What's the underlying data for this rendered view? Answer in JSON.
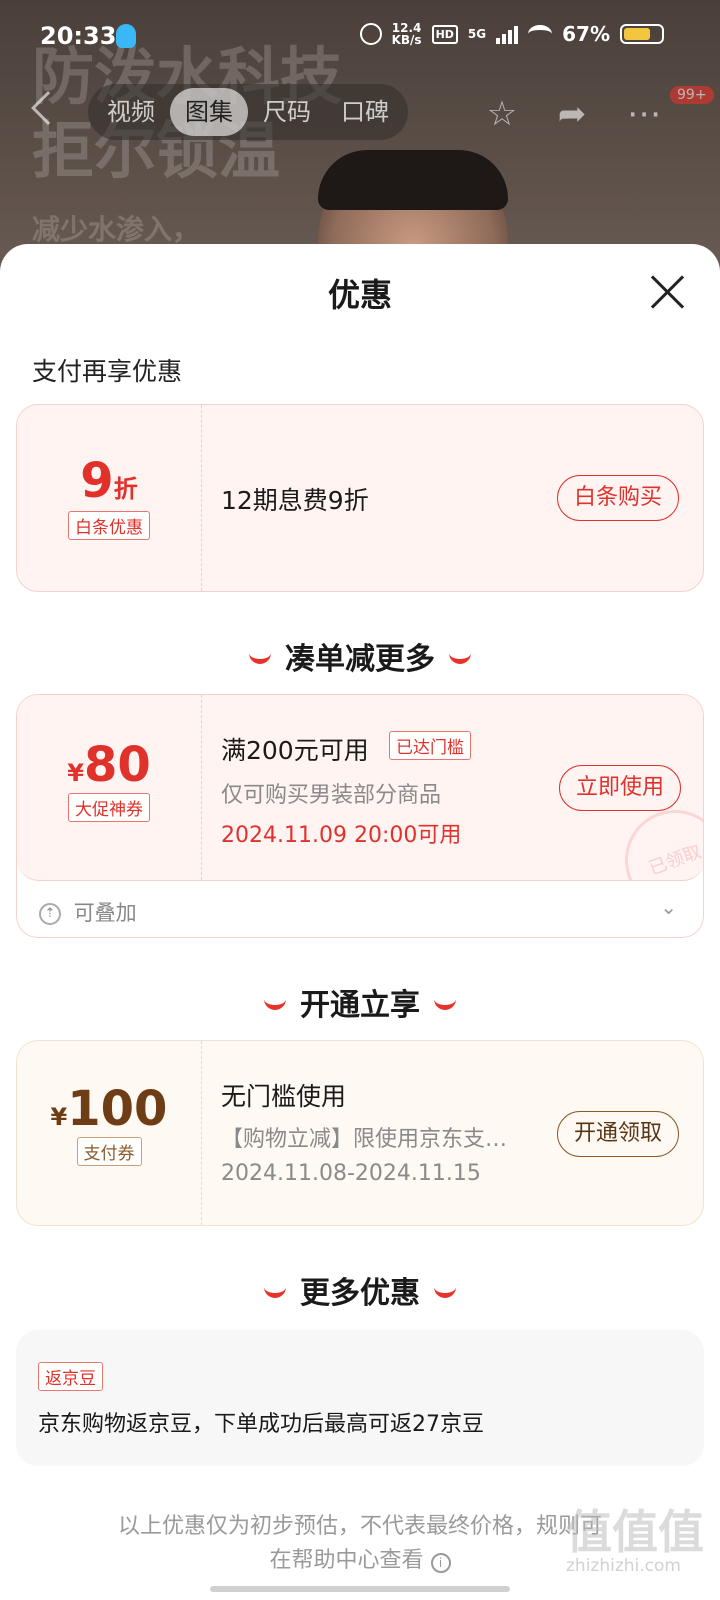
{
  "status": {
    "time": "20:33",
    "speed_value": "12.4",
    "speed_unit": "KB/s",
    "hd": "HD",
    "net": "5G",
    "battery": "67%"
  },
  "hero": {
    "line1": "防泼水科技",
    "line2": "拒尔锁温",
    "line3": "减少水渗入，"
  },
  "nav": {
    "tabs": [
      "视频",
      "图集",
      "尺码",
      "口碑"
    ],
    "active_tab": "图集",
    "badge": "99+"
  },
  "sheet": {
    "title": "优惠",
    "pay_section": "支付再享优惠",
    "baitiao": {
      "amount": "9",
      "unit": "折",
      "tag": "白条优惠",
      "desc": "12期息费9折",
      "button": "白条购买"
    },
    "section2": "凑单减更多",
    "coupon80": {
      "currency": "¥",
      "amount": "80",
      "tag": "大促神券",
      "title": "满200元可用",
      "status_tag": "已达门槛",
      "scope": "仅可购买男装部分商品",
      "time": "2024.11.09 20:00可用",
      "button": "立即使用",
      "stamp": "已领取",
      "stack_label": "可叠加"
    },
    "section3": "开通立享",
    "coupon100": {
      "currency": "¥",
      "amount": "100",
      "tag": "支付券",
      "title": "无门槛使用",
      "scope": "【购物立减】限使用京东支…",
      "time": "2024.11.08-2024.11.15",
      "button": "开通领取"
    },
    "section4": "更多优惠",
    "jingdou": {
      "tag": "返京豆",
      "desc": "京东购物返京豆，下单成功后最高可返27京豆"
    },
    "footer_line1": "以上优惠仅为初步预估，不代表最终价格，规则可",
    "footer_line2": "在帮助中心查看",
    "watermark": "值值值",
    "watermark_url": "zhizhizhi.com"
  },
  "colors": {
    "accent": "#e0312b",
    "gold": "#8a5a2b"
  }
}
